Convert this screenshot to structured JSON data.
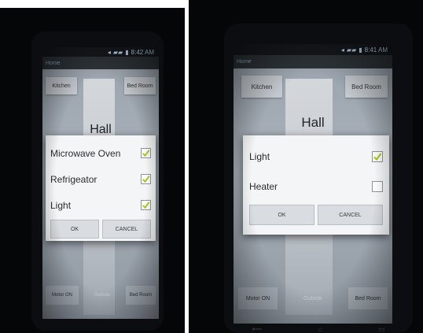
{
  "left_phone": {
    "status_time": "8:42 AM",
    "app_title": "Home",
    "nav_left": "Kitchen",
    "nav_right": "Bed Room",
    "room_title": "Hall",
    "dialog": {
      "items": [
        {
          "label": "Microwave Oven",
          "checked": true
        },
        {
          "label": "Refrigeator",
          "checked": true
        },
        {
          "label": "Light",
          "checked": true
        }
      ],
      "ok_label": "OK",
      "cancel_label": "CANCEL"
    },
    "bottom": {
      "left": "Motor ON",
      "middle": "Outside",
      "right": "Bed Room"
    }
  },
  "right_phone": {
    "status_time": "8:41 AM",
    "app_title": "Home",
    "nav_left": "Kitchen",
    "nav_right": "Bed Room",
    "room_title": "Hall",
    "dialog": {
      "items": [
        {
          "label": "Light",
          "checked": true
        },
        {
          "label": "Heater",
          "checked": false
        }
      ],
      "ok_label": "OK",
      "cancel_label": "CANCEL"
    },
    "bottom": {
      "left": "Motor ON",
      "middle": "Outside",
      "right": "Bed Room"
    }
  },
  "colors": {
    "check_mark": "#a6c81e",
    "app_bar": "#2d3338",
    "status_icons": "#b9d4f0"
  }
}
